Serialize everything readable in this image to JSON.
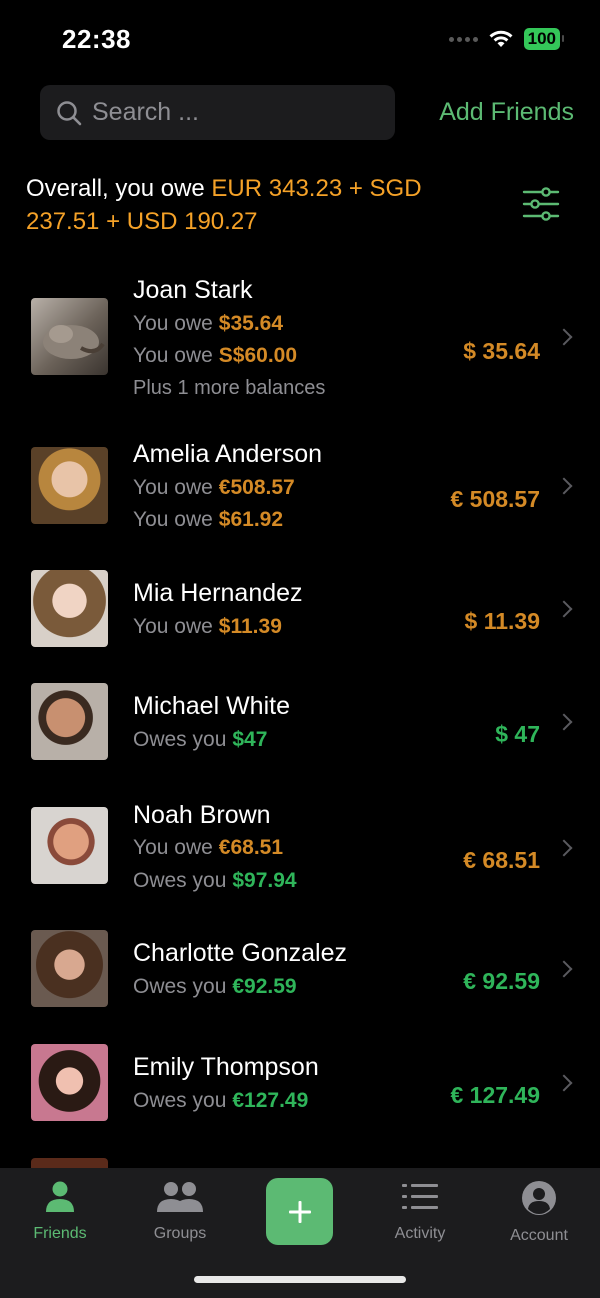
{
  "status": {
    "time": "22:38",
    "battery": "100"
  },
  "search": {
    "placeholder": "Search ..."
  },
  "header": {
    "add_friends_label": "Add Friends"
  },
  "summary": {
    "prefix": "Overall, you owe",
    "eur": "EUR 343.23",
    "plus1": "+",
    "sgd": "SGD 237.51",
    "plus2": "+",
    "usd": "USD 190.27"
  },
  "friends": [
    {
      "name": "Joan Stark",
      "lines": [
        {
          "label": "You owe",
          "value": "$35.64",
          "kind": "owe"
        },
        {
          "label": "You owe",
          "value": "S$60.00",
          "kind": "owe"
        }
      ],
      "more": "Plus 1 more balances",
      "total": "$ 35.64",
      "total_kind": "owe"
    },
    {
      "name": "Amelia Anderson",
      "lines": [
        {
          "label": "You owe",
          "value": "€508.57",
          "kind": "owe"
        },
        {
          "label": "You owe",
          "value": "$61.92",
          "kind": "owe"
        }
      ],
      "total": "€ 508.57",
      "total_kind": "owe"
    },
    {
      "name": "Mia Hernandez",
      "lines": [
        {
          "label": "You owe",
          "value": "$11.39",
          "kind": "owe"
        }
      ],
      "total": "$ 11.39",
      "total_kind": "owe"
    },
    {
      "name": "Michael White",
      "lines": [
        {
          "label": "Owes you",
          "value": "$47",
          "kind": "owed"
        }
      ],
      "total": "$ 47",
      "total_kind": "owed"
    },
    {
      "name": "Noah Brown",
      "lines": [
        {
          "label": "You owe",
          "value": "€68.51",
          "kind": "owe"
        },
        {
          "label": "Owes you",
          "value": "$97.94",
          "kind": "owed"
        }
      ],
      "total": "€ 68.51",
      "total_kind": "owe"
    },
    {
      "name": "Charlotte Gonzalez",
      "lines": [
        {
          "label": "Owes you",
          "value": "€92.59",
          "kind": "owed"
        }
      ],
      "total": "€ 92.59",
      "total_kind": "owed"
    },
    {
      "name": "Emily Thompson",
      "lines": [
        {
          "label": "Owes you",
          "value": "€127.49",
          "kind": "owed"
        }
      ],
      "total": "€ 127.49",
      "total_kind": "owed"
    }
  ],
  "tabs": [
    {
      "label": "Friends",
      "icon": "person-icon",
      "active": true
    },
    {
      "label": "Groups",
      "icon": "group-icon",
      "active": false
    },
    {
      "label": "Activity",
      "icon": "list-icon",
      "active": false
    },
    {
      "label": "Account",
      "icon": "account-icon",
      "active": false
    }
  ],
  "colors": {
    "accent": "#5cba73",
    "owe": "#d48a26",
    "owed": "#2fb55a",
    "summary_amount": "#f5a228"
  }
}
